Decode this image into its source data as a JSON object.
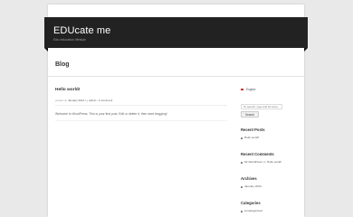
{
  "site": {
    "title": "EDUcate me",
    "description": "Edu education lifestyle"
  },
  "page": {
    "title": "Blog"
  },
  "post": {
    "title": "Hello world!",
    "meta_prefix": "posted on",
    "date": "January 2014",
    "meta_by": "by",
    "author": "admin",
    "comments": "1 Comment",
    "body": "Welcome to WordPress. This is your first post. Edit or delete it, then start blogging!"
  },
  "sidebar": {
    "language": "English",
    "search_placeholder": "To search, type and hit enter",
    "search_button": "Search",
    "recent_posts": {
      "title": "Recent Posts",
      "items": [
        "Hello world!"
      ]
    },
    "recent_comments": {
      "title": "Recent Comments",
      "author": "Mr WordPress",
      "on_word": "on",
      "post": "Hello world!"
    },
    "archives": {
      "title": "Archives",
      "items": [
        "January 2014"
      ]
    },
    "categories": {
      "title": "Categories",
      "items": [
        "Uncategorized"
      ]
    }
  },
  "colors": {
    "background": "#e9e9e9",
    "header": "#222222",
    "page": "#ffffff"
  }
}
